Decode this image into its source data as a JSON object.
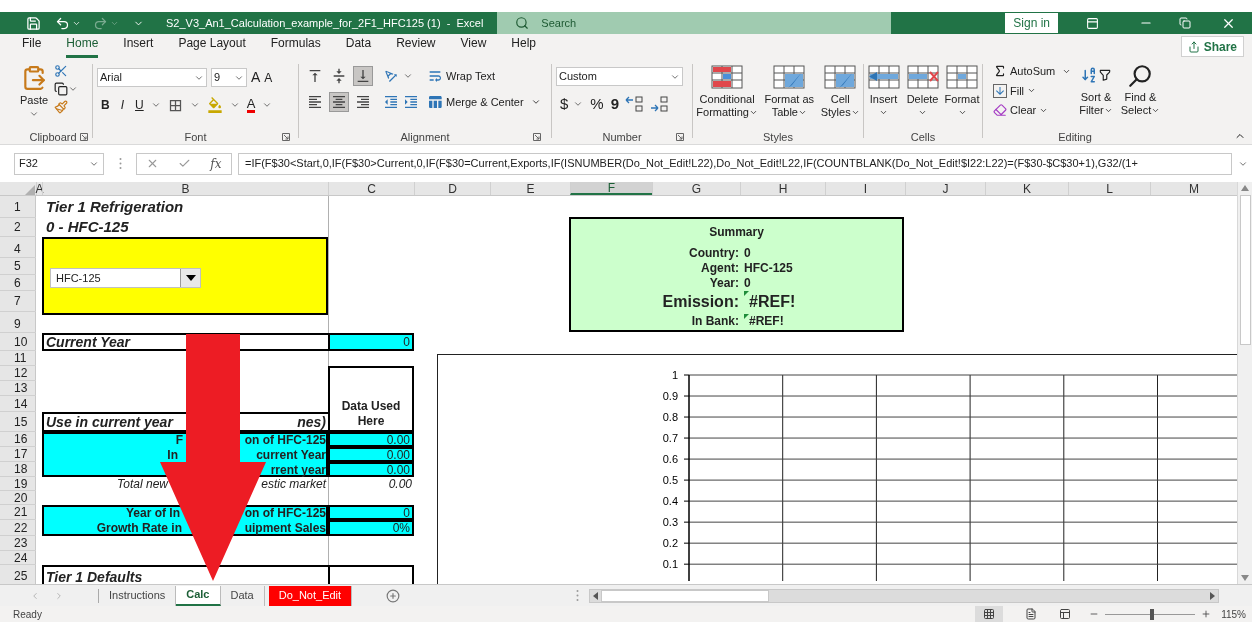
{
  "title_bar": {
    "title": "S2_V3_An1_Calculation_example_for_2F1_HFC125 (1)  -  Excel",
    "search_placeholder": "Search",
    "sign_in": "Sign in"
  },
  "menu_tabs": [
    {
      "label": "File",
      "selected": false
    },
    {
      "label": "Home",
      "selected": true
    },
    {
      "label": "Insert",
      "selected": false
    },
    {
      "label": "Page Layout",
      "selected": false
    },
    {
      "label": "Formulas",
      "selected": false
    },
    {
      "label": "Data",
      "selected": false
    },
    {
      "label": "Review",
      "selected": false
    },
    {
      "label": "View",
      "selected": false
    },
    {
      "label": "Help",
      "selected": false
    }
  ],
  "share": "Share",
  "clipboard": {
    "paste": "Paste",
    "label": "Clipboard"
  },
  "font": {
    "name": "Arial",
    "size": "9",
    "grow": "A",
    "shrink": "A",
    "bold": "B",
    "italic": "I",
    "underline": "U",
    "font_color": "A",
    "label": "Font"
  },
  "alignment": {
    "vertical": [
      {
        "selected": false
      },
      {
        "selected": false
      },
      {
        "selected": true
      }
    ],
    "horizontal": [
      {
        "selected": false
      },
      {
        "selected": true
      },
      {
        "selected": false
      }
    ],
    "wrap": "Wrap Text",
    "merge": "Merge & Center",
    "label": "Alignment"
  },
  "number": {
    "format": "Custom",
    "currency": "$",
    "percent": "%",
    "comma": "9",
    "label": "Number"
  },
  "styles": {
    "buttons": [
      [
        "Conditional",
        "Formatting"
      ],
      [
        "Format as",
        "Table"
      ],
      [
        "Cell",
        "Styles"
      ]
    ],
    "label": "Styles"
  },
  "cells": {
    "buttons": [
      "Insert",
      "Delete",
      "Format"
    ],
    "label": "Cells"
  },
  "editing": {
    "autosum": "AutoSum",
    "fill": "Fill",
    "clear": "Clear",
    "sort": [
      "Sort &",
      "Filter"
    ],
    "find": [
      "Find &",
      "Select"
    ],
    "label": "Editing"
  },
  "formula_bar": {
    "name_box": "F32",
    "fx": "fx",
    "formula": "=IF(F$30<Start,0,IF(F$30>Current,0,IF(F$30=Current,Exports,IF(ISNUMBER(Do_Not_Edit!L22),Do_Not_Edit!L22,IF(COUNTBLANK(Do_Not_Edit!$I22:L22)=(F$30-$C$30+1),G32/(1+"
  },
  "columns": [
    {
      "label": "A",
      "selected": false
    },
    {
      "label": "B",
      "selected": false
    },
    {
      "label": "C",
      "selected": false
    },
    {
      "label": "D",
      "selected": false
    },
    {
      "label": "E",
      "selected": false
    },
    {
      "label": "F",
      "selected": true
    },
    {
      "label": "G",
      "selected": false
    },
    {
      "label": "H",
      "selected": false
    },
    {
      "label": "I",
      "selected": false
    },
    {
      "label": "J",
      "selected": false
    },
    {
      "label": "K",
      "selected": false
    },
    {
      "label": "L",
      "selected": false
    },
    {
      "label": "M",
      "selected": false
    }
  ],
  "rows": [
    {
      "label": "1"
    },
    {
      "label": "2"
    },
    {
      "kind": "collapsed"
    },
    {
      "label": "4"
    },
    {
      "label": "5"
    },
    {
      "label": "6"
    },
    {
      "label": "7"
    },
    {
      "kind": "collapsed"
    },
    {
      "label": "9"
    },
    {
      "label": "10"
    },
    {
      "label": "11"
    },
    {
      "label": "12"
    },
    {
      "label": "13"
    },
    {
      "label": "14"
    },
    {
      "label": "15"
    },
    {
      "label": "16"
    },
    {
      "label": "17"
    },
    {
      "label": "18"
    },
    {
      "label": "19"
    },
    {
      "label": "20"
    },
    {
      "label": "21"
    },
    {
      "label": "22"
    },
    {
      "label": "23"
    },
    {
      "label": "24"
    },
    {
      "label": "25"
    }
  ],
  "sheet": {
    "title": "Tier 1 Refrigeration",
    "subtitle": "0 - HFC-125",
    "agent_dropdown": "HFC-125",
    "current_year": {
      "label": "Current Year",
      "value": "0"
    },
    "data_header": "Data Used Here",
    "use_header": {
      "left": "Use in current year",
      "right": "nes)"
    },
    "use_rows": [
      {
        "kind": "input",
        "left": "F",
        "right": "on of HFC-125",
        "value": "0.00"
      },
      {
        "kind": "input",
        "left": "In",
        "right": "current Year",
        "value": "0.00"
      },
      {
        "kind": "input",
        "right": "rrent year",
        "value": "0.00"
      },
      {
        "kind": "total",
        "left": "Total new",
        "right": "estic market",
        "value": "0.00"
      }
    ],
    "intro_rows": [
      {
        "left": "Year of In",
        "right": "on of HFC-125",
        "value": "0"
      },
      {
        "left": "Growth Rate in",
        "right": "uipment Sales",
        "value": "0%"
      }
    ],
    "defaults_header": "Tier 1 Defaults"
  },
  "summary": {
    "title": "Summary",
    "rows": [
      {
        "kind": "plain",
        "label": "Country:",
        "value": "0"
      },
      {
        "kind": "plain",
        "label": "Agent:",
        "value": "HFC-125"
      },
      {
        "kind": "plain",
        "label": "Year:",
        "value": "0"
      },
      {
        "kind": "large",
        "label": "Emission:",
        "value": "#REF!"
      },
      {
        "kind": "flagged",
        "label": "In Bank:",
        "value": "#REF!"
      }
    ]
  },
  "chart": {
    "chart_data": {
      "type": "line",
      "categories": [
        null,
        null,
        null,
        null,
        null,
        null
      ],
      "values": [
        null,
        null,
        null,
        null,
        null,
        null
      ],
      "ylim": [
        0.02,
        1
      ],
      "grid": true,
      "yticks": [
        0.1,
        0.2,
        0.3,
        0.4,
        0.5,
        0.6,
        0.7,
        0.8,
        0.9,
        1
      ]
    }
  },
  "sheet_tabs": [
    {
      "label": "Instructions",
      "selected": false
    },
    {
      "label": "Calc",
      "selected": true
    },
    {
      "label": "Data",
      "selected": false
    },
    {
      "label": "Do_Not_Edit",
      "selected": false,
      "color": "#ff0000"
    }
  ],
  "status": {
    "text": "Ready",
    "zoom": "115%",
    "zoom_slider": {
      "level": 0.52
    }
  }
}
